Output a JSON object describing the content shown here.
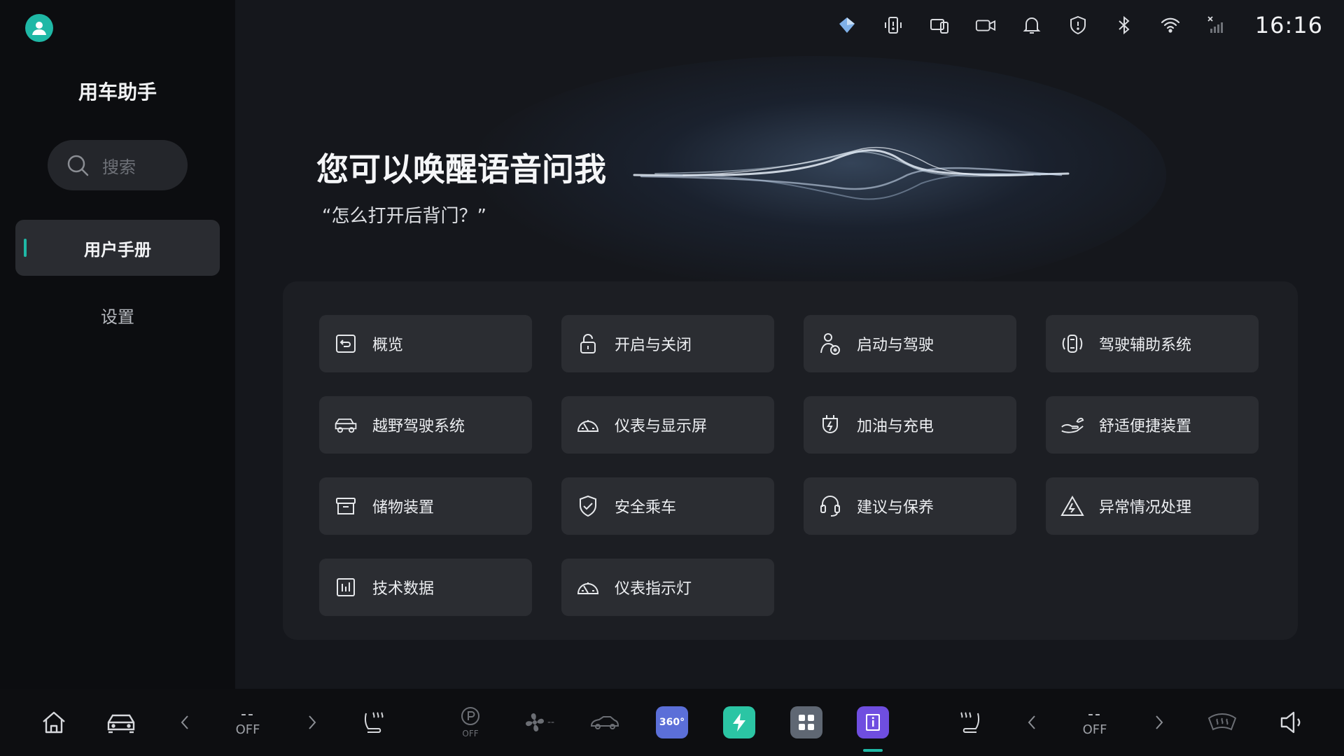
{
  "status_bar": {
    "icons": [
      "gem-icon",
      "phone-alert-icon",
      "screen-share-icon",
      "camera-icon",
      "bell-icon",
      "shield-icon",
      "bluetooth-icon",
      "wifi-icon",
      "no-signal-icon"
    ],
    "time": "16:16"
  },
  "sidebar": {
    "title": "用车助手",
    "search_placeholder": "搜索",
    "items": [
      {
        "label": "用户手册",
        "active": true
      },
      {
        "label": "设置",
        "active": false
      }
    ]
  },
  "hero": {
    "title": "您可以唤醒语音问我",
    "subtitle": "“怎么打开后背门？”"
  },
  "categories": [
    {
      "label": "概览",
      "icon": "overview-icon"
    },
    {
      "label": "开启与关闭",
      "icon": "lock-icon"
    },
    {
      "label": "启动与驾驶",
      "icon": "driver-icon"
    },
    {
      "label": "驾驶辅助系统",
      "icon": "driver-assist-icon"
    },
    {
      "label": "越野驾驶系统",
      "icon": "offroad-vehicle-icon"
    },
    {
      "label": "仪表与显示屏",
      "icon": "gauge-icon"
    },
    {
      "label": "加油与充电",
      "icon": "charging-plug-icon"
    },
    {
      "label": "舒适便捷装置",
      "icon": "comfort-hand-icon"
    },
    {
      "label": "储物装置",
      "icon": "storage-box-icon"
    },
    {
      "label": "安全乘车",
      "icon": "safety-shield-icon"
    },
    {
      "label": "建议与保养",
      "icon": "headset-icon"
    },
    {
      "label": "异常情况处理",
      "icon": "warning-triangle-icon"
    },
    {
      "label": "技术数据",
      "icon": "data-chart-icon"
    },
    {
      "label": "仪表指示灯",
      "icon": "gauge-icon"
    }
  ],
  "dock": {
    "left_temp": "--",
    "left_status": "OFF",
    "right_temp": "--",
    "right_status": "OFF",
    "parking_status": "OFF",
    "camera_360_label": "360°",
    "fan_level": "--"
  },
  "colors": {
    "accent": "#1fb8a6",
    "camera_360_bg": "#5b6fd8",
    "charge_app_bg": "#2bc5a4",
    "apps_grid_bg": "#5f6773",
    "manual_app_bg": "#6f4ee0"
  }
}
